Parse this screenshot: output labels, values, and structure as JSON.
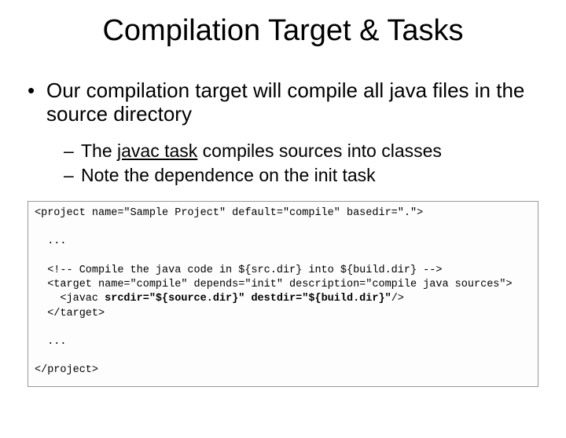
{
  "title": "Compilation Target & Tasks",
  "bullet1": "Our compilation target will compile all java files in the source directory",
  "bullet2a_pre": "The ",
  "bullet2a_link": "javac task",
  "bullet2a_post": " compiles sources into classes",
  "bullet2b": "Note the dependence on the init task",
  "code": {
    "l1": "<project name=\"Sample Project\" default=\"compile\" basedir=\".\">",
    "blank": "",
    "dots": "  ...",
    "l4": "  <!-- Compile the java code in ${src.dir} into ${build.dir} -->",
    "l5": "  <target name=\"compile\" depends=\"init\" description=\"compile java sources\">",
    "l6a": "    <javac ",
    "l6b": "srcdir=\"${source.dir}\" destdir=\"${build.dir}\"",
    "l6c": "/>",
    "l7": "  </target>",
    "l10": "</project>"
  }
}
